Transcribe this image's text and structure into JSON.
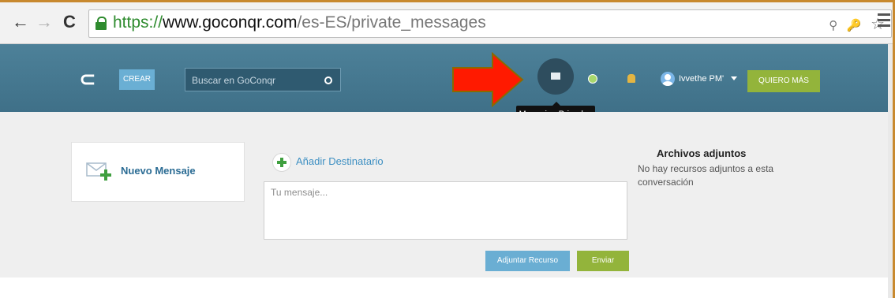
{
  "browser": {
    "url_scheme": "https://",
    "url_host": "www.goconqr.com",
    "url_path": "/es-ES/private_messages",
    "back_glyph": "←",
    "forward_glyph": "→",
    "reload_glyph": "C",
    "zoom_glyph": "🔍",
    "star_glyph": "☆"
  },
  "header": {
    "logo_glyph": "ᏣC",
    "create_label": "CREAR",
    "search_placeholder": "Buscar en GoConqr",
    "user_name": "Ivvethe PM'",
    "cta_label": "QUIERO MÁS",
    "tooltip": "Mensajes Privados"
  },
  "icons": {
    "messages": "envelope-icon",
    "explore": "globe-icon",
    "notifications": "bell-icon",
    "user": "avatar-icon"
  },
  "colors": {
    "header_bg": "#457790",
    "create_btn": "#6aafd4",
    "cta_btn": "#93b43b",
    "annotation_arrow": "#ff0000"
  },
  "main": {
    "new_message_label": "Nuevo Mensaje",
    "add_recipient_label": "Añadir Destinatario",
    "message_placeholder": "Tu mensaje...",
    "attach_resource_label": "Adjuntar Recurso",
    "send_label": "Enviar"
  },
  "attachments": {
    "title": "Archivos adjuntos",
    "empty_text": "No hay recursos adjuntos a esta conversación"
  }
}
